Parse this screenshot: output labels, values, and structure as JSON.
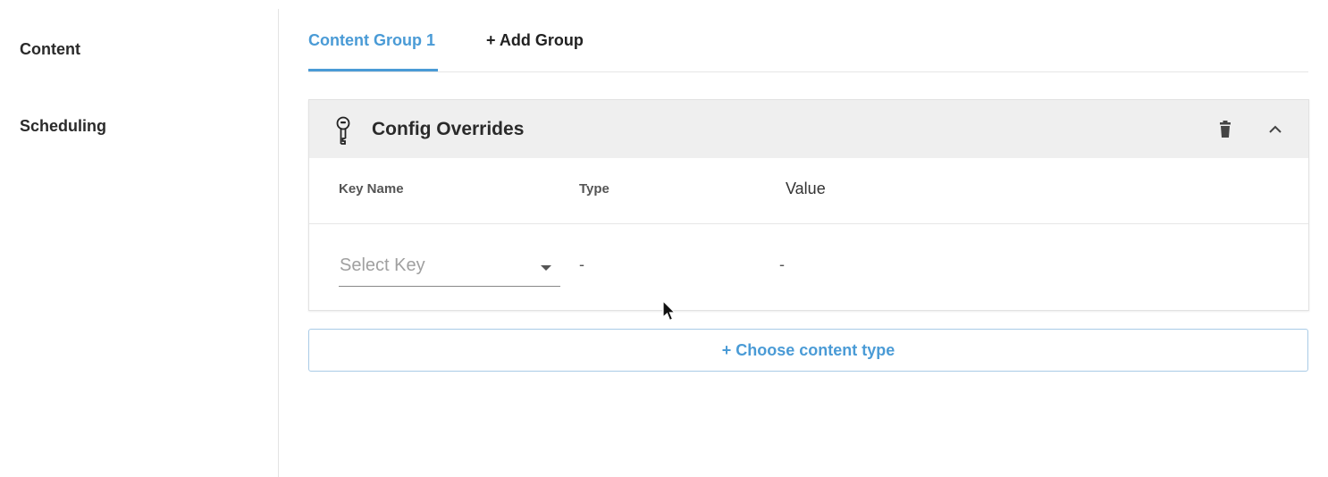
{
  "nav": {
    "items": [
      {
        "label": "Content"
      },
      {
        "label": "Scheduling"
      }
    ]
  },
  "tabs": {
    "active_label": "Content Group 1",
    "add_label": "+ Add Group"
  },
  "card": {
    "icon": "key-icon",
    "title": "Config Overrides",
    "columns": {
      "key": "Key Name",
      "type": "Type",
      "value": "Value"
    },
    "row": {
      "key_placeholder": "Select Key",
      "type": "-",
      "value": "-"
    }
  },
  "choose_label": "+ Choose content type",
  "colors": {
    "accent": "#4a9bd6",
    "header_bg": "#efefef"
  }
}
